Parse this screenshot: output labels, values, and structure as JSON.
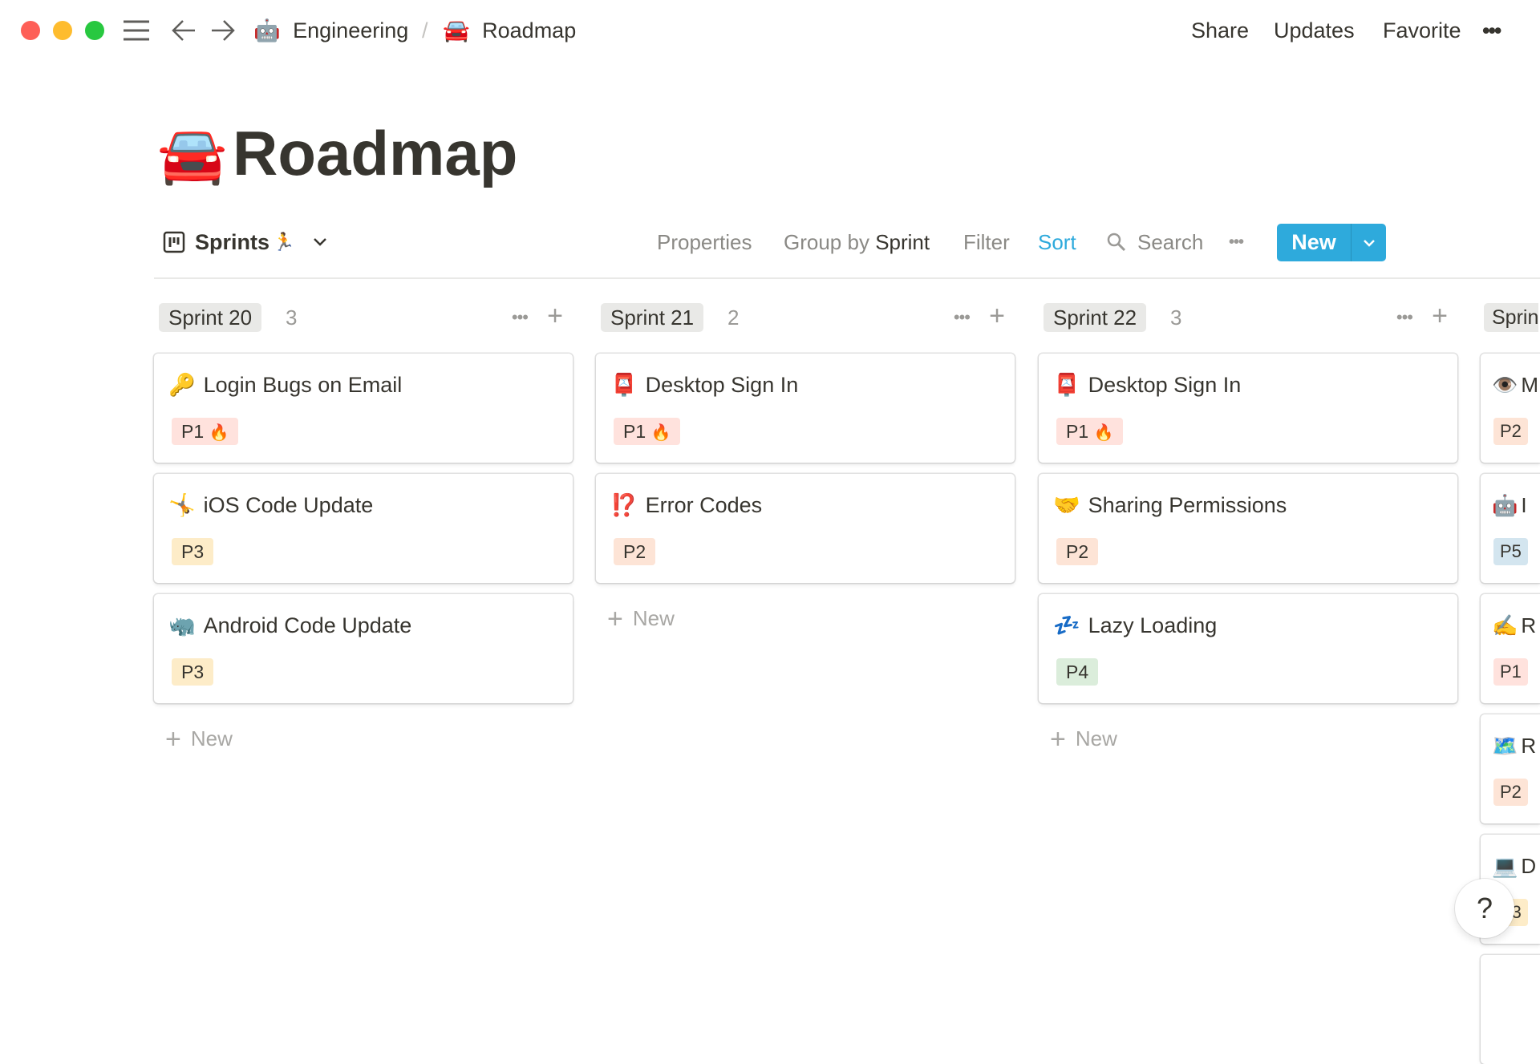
{
  "window": {
    "traffic_lights": {
      "close": "#fe5f57",
      "minimize": "#febc2e",
      "zoom": "#28c840"
    }
  },
  "topbar": {
    "breadcrumb": [
      {
        "icon": "🤖",
        "label": "Engineering"
      },
      {
        "icon": "🚘",
        "label": "Roadmap"
      }
    ],
    "separator": "/",
    "share": "Share",
    "updates": "Updates",
    "favorite": "Favorite",
    "more": "•••"
  },
  "page": {
    "icon": "🚘",
    "title": "Roadmap"
  },
  "view": {
    "name": "Sprints",
    "name_emoji": "🏃",
    "properties": "Properties",
    "group_by_prefix": "Group by",
    "group_by_value": "Sprint",
    "filter": "Filter",
    "sort": "Sort",
    "search": "Search",
    "more": "•••",
    "new": "New",
    "accent": "#2eaadc"
  },
  "columns": [
    {
      "name": "Sprint 20",
      "count": "3",
      "new_label": "New",
      "cards": [
        {
          "icon": "🔑",
          "title": "Login Bugs on Email",
          "priority": "P1",
          "priority_emoji": "🔥"
        },
        {
          "icon": "🤸",
          "title": "iOS Code Update",
          "priority": "P3",
          "priority_emoji": ""
        },
        {
          "icon": "🦏",
          "title": "Android Code Update",
          "priority": "P3",
          "priority_emoji": ""
        }
      ]
    },
    {
      "name": "Sprint 21",
      "count": "2",
      "new_label": "New",
      "cards": [
        {
          "icon": "📮",
          "title": "Desktop Sign In",
          "priority": "P1",
          "priority_emoji": "🔥"
        },
        {
          "icon": "⁉️",
          "title": "Error Codes",
          "priority": "P2",
          "priority_emoji": ""
        }
      ]
    },
    {
      "name": "Sprint 22",
      "count": "3",
      "new_label": "New",
      "cards": [
        {
          "icon": "📮",
          "title": "Desktop Sign In",
          "priority": "P1",
          "priority_emoji": "🔥"
        },
        {
          "icon": "🤝",
          "title": "Sharing Permissions",
          "priority": "P2",
          "priority_emoji": ""
        },
        {
          "icon": "💤",
          "title": "Lazy Loading",
          "priority": "P4",
          "priority_emoji": ""
        }
      ]
    },
    {
      "name": "Sprin",
      "count": "",
      "new_label": "",
      "cards": [
        {
          "icon": "👁️",
          "title": "M",
          "priority": "P2",
          "priority_emoji": ""
        },
        {
          "icon": "🤖",
          "title": "I",
          "priority": "P5",
          "priority_emoji": ""
        },
        {
          "icon": "✍️",
          "title": "R",
          "priority": "P1",
          "priority_emoji": "🔥"
        },
        {
          "icon": "🗺️",
          "title": "R",
          "priority": "P2",
          "priority_emoji": ""
        },
        {
          "icon": "💻",
          "title": "D",
          "priority": "P3",
          "priority_emoji": ""
        }
      ]
    }
  ],
  "priority_colors": {
    "P1": "#ffe2dd",
    "P2": "#fde4d6",
    "P3": "#fdecc8",
    "P4": "#dbeddb",
    "P5": "#d3e5ef"
  },
  "help": "?"
}
